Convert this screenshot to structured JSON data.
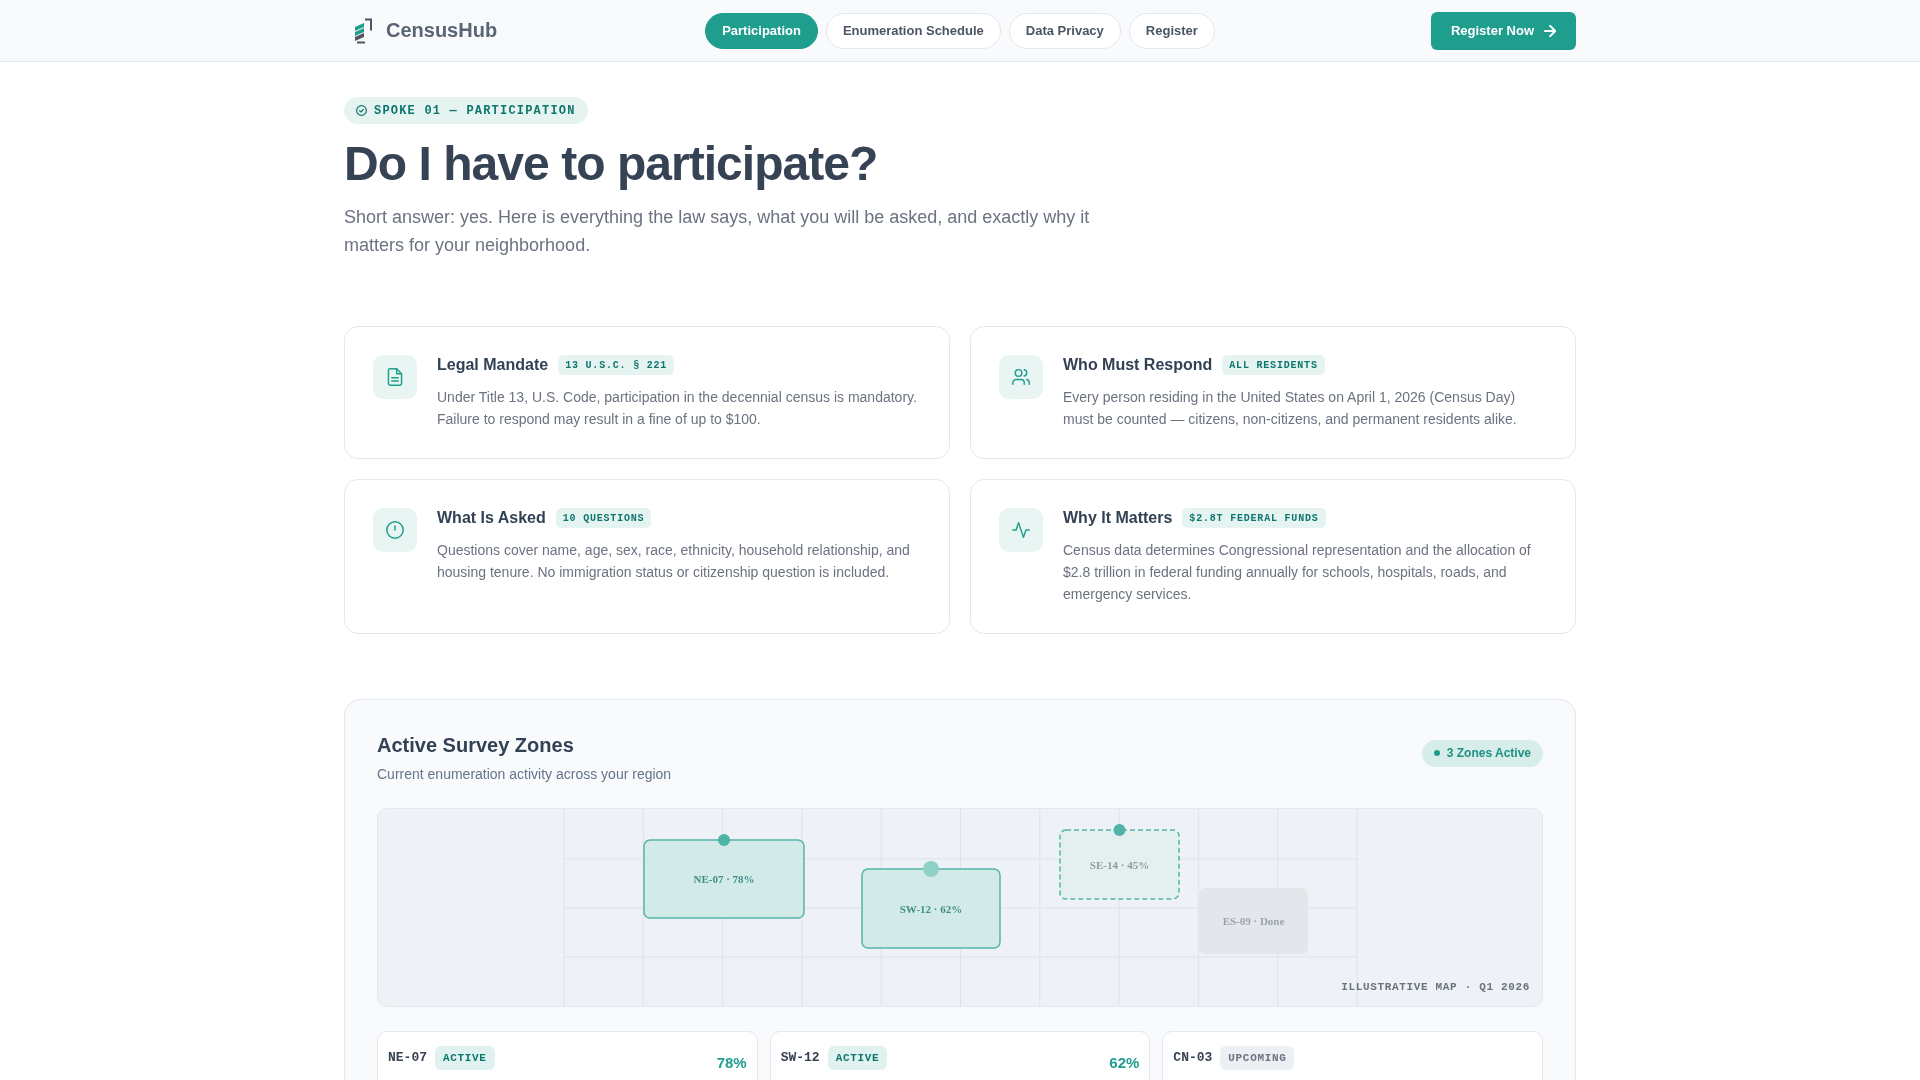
{
  "header": {
    "brand": "CensusHub",
    "nav": [
      {
        "label": "Participation",
        "selected": true
      },
      {
        "label": "Enumeration Schedule",
        "selected": false
      },
      {
        "label": "Data Privacy",
        "selected": false
      },
      {
        "label": "Register",
        "selected": false
      }
    ],
    "cta": "Register Now"
  },
  "hero": {
    "eyebrow": "SPOKE 01 — PARTICIPATION",
    "title": "Do I have to participate?",
    "lead": "Short answer: yes. Here is everything the law says, what you will be asked, and exactly why it matters for your neighborhood."
  },
  "facts": [
    {
      "kind": "document",
      "title": "Legal Mandate",
      "tag": "13 U.S.C. § 221",
      "text": "Under Title 13, U.S. Code, participation in the decennial census is mandatory. Failure to respond may result in a fine of up to $100."
    },
    {
      "kind": "people",
      "title": "Who Must Respond",
      "tag": "ALL RESIDENTS",
      "text": "Every person residing in the United States on April 1, 2026 (Census Day) must be counted — citizens, non-citizens, and permanent residents alike."
    },
    {
      "kind": "question",
      "title": "What Is Asked",
      "tag": "10 QUESTIONS",
      "text": "Questions cover name, age, sex, race, ethnicity, household relationship, and housing tenure. No immigration status or citizenship question is included."
    },
    {
      "kind": "pulse",
      "title": "Why It Matters",
      "tag": "$2.8T FEDERAL FUNDS",
      "text": "Census data determines Congressional representation and the allocation of $2.8 trillion in federal funding annually for schools, hospitals, roads, and emergency services."
    }
  ],
  "zones_panel": {
    "title": "Active Survey Zones",
    "subtitle": "Current enumeration activity across your region",
    "badge": "3 Zones Active",
    "map": {
      "caption": "ILLUSTRATIVE MAP · Q1 2026",
      "zones": [
        {
          "label": "NE-07 · 78%",
          "kind": "active"
        },
        {
          "label": "SW-12 · 62%",
          "kind": "active"
        },
        {
          "label": "SE-14 · 45%",
          "kind": "upcoming"
        },
        {
          "label": "ES-09 · Done",
          "kind": "done"
        }
      ]
    },
    "cards": [
      {
        "code": "NE-07",
        "status": "ACTIVE",
        "kind": "active",
        "percent": "78%"
      },
      {
        "code": "SW-12",
        "status": "ACTIVE",
        "kind": "active",
        "percent": "62%"
      },
      {
        "code": "CN-03",
        "status": "UPCOMING",
        "kind": "upcoming"
      }
    ]
  }
}
